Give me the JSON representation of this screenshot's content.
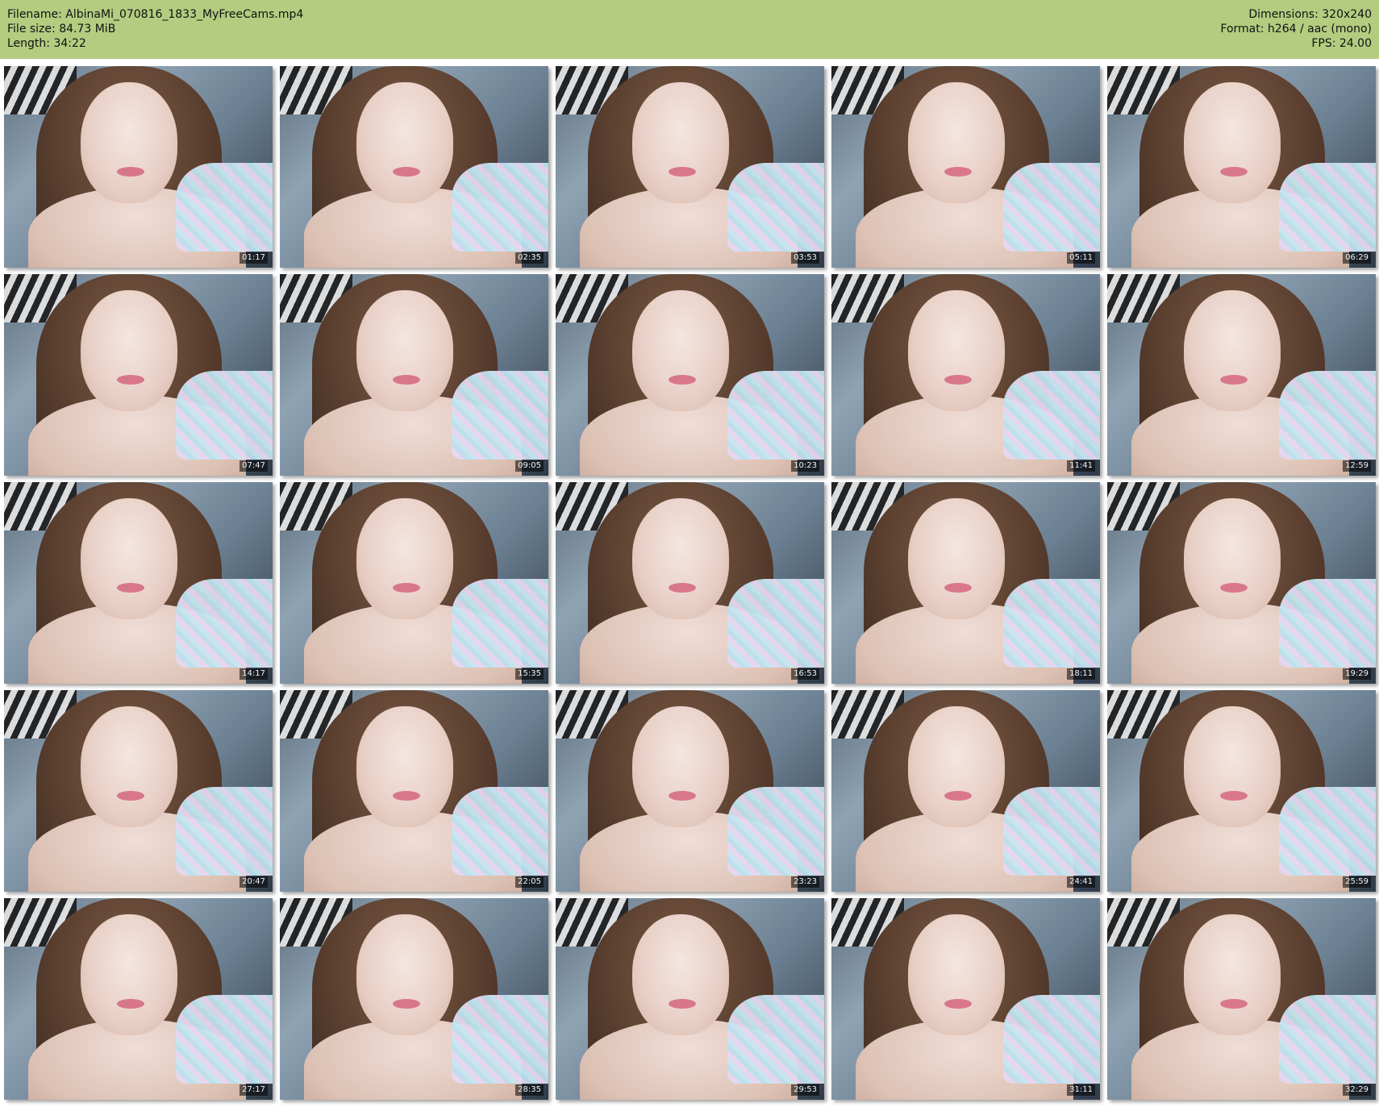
{
  "header": {
    "left": [
      "Filename: AlbinaMi_070816_1833_MyFreeCams.mp4",
      "File size: 84.73 MiB",
      "Length: 34:22"
    ],
    "right": [
      "Dimensions: 320x240",
      "Format: h264 / aac (mono)",
      "FPS: 24.00"
    ]
  },
  "thumbnails": [
    {
      "time": "01:17"
    },
    {
      "time": "02:35"
    },
    {
      "time": "03:53"
    },
    {
      "time": "05:11"
    },
    {
      "time": "06:29"
    },
    {
      "time": "07:47"
    },
    {
      "time": "09:05"
    },
    {
      "time": "10:23"
    },
    {
      "time": "11:41"
    },
    {
      "time": "12:59"
    },
    {
      "time": "14:17"
    },
    {
      "time": "15:35"
    },
    {
      "time": "16:53"
    },
    {
      "time": "18:11"
    },
    {
      "time": "19:29"
    },
    {
      "time": "20:47"
    },
    {
      "time": "22:05"
    },
    {
      "time": "23:23"
    },
    {
      "time": "24:41"
    },
    {
      "time": "25:59"
    },
    {
      "time": "27:17"
    },
    {
      "time": "28:35"
    },
    {
      "time": "29:53"
    },
    {
      "time": "31:11"
    },
    {
      "time": "32:29"
    }
  ],
  "colors": {
    "header_background": "#b3cc80",
    "timestamp_text": "#f2f2f2"
  }
}
